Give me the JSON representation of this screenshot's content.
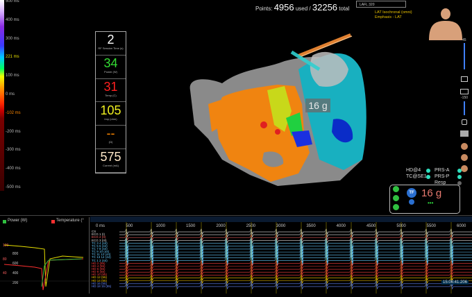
{
  "scale": {
    "labels": [
      {
        "text": "500 ms",
        "color": "#bbbbbb"
      },
      {
        "text": "400 ms",
        "color": "#bbbbbb"
      },
      {
        "text": "300 ms",
        "color": "#bbbbbb"
      },
      {
        "text": "221 ms",
        "color": "#e8e000"
      },
      {
        "text": "100 ms",
        "color": "#bbbbbb"
      },
      {
        "text": "0 ms",
        "color": "#bbbbbb"
      },
      {
        "text": "-102 ms",
        "color": "#ff8800"
      },
      {
        "text": "-200 ms",
        "color": "#bbbbbb"
      },
      {
        "text": "-300 ms",
        "color": "#bbbbbb"
      },
      {
        "text": "-400 ms",
        "color": "#bbbbbb"
      },
      {
        "text": "-500 ms",
        "color": "#bbbbbb"
      }
    ]
  },
  "header": {
    "points_prefix": "Points:",
    "used": "4956",
    "used_suffix": "used /",
    "total": "32256",
    "total_suffix": "total",
    "map_name": "LAFL 320",
    "map_mode": "LAT Isochronal (omni)",
    "emphasis": "Emphasis - LAT"
  },
  "readouts": [
    {
      "value": "2",
      "label": "RF Session Time (s)",
      "color": "#ffffff"
    },
    {
      "value": "34",
      "label": "Power (W)",
      "color": "#33dd33"
    },
    {
      "value": "31",
      "label": "Temp (C)",
      "color": "#ff2020"
    },
    {
      "value": "105",
      "label": "Imp (ohm)",
      "color": "#f0f020"
    },
    {
      "value": "--",
      "label": "(Ω)",
      "color": "#ff8800"
    },
    {
      "value": "575",
      "label": "Current (mA)",
      "color": "#ffe8c8"
    }
  ],
  "map_force": "16 g",
  "toolbar": {
    "number_top": "45",
    "number_mid": "-150"
  },
  "force_panel": {
    "hd": "HD@4",
    "tc": "TC@SE1",
    "prs_a": "PRS-A",
    "prs_p": "PRS-P",
    "resp": "Resp",
    "tf": "TF",
    "value": "16 g",
    "dots": "•••"
  },
  "left_panel": {
    "power_label": "Power (W)",
    "temp_label": "Temperature (°",
    "axis": [
      "800",
      "600",
      "400",
      "200"
    ],
    "axis2": [
      "120",
      "80",
      "40"
    ]
  },
  "ecg": {
    "time_labels": [
      "0 ms",
      "500",
      "1000",
      "1500",
      "2000",
      "2500",
      "3000",
      "3500",
      "4000",
      "4500",
      "5000",
      "5500",
      "6000"
    ],
    "timestamp": "15:06:41.206",
    "channels": [
      {
        "name": "CS",
        "color": "#dddddd"
      },
      {
        "name": "ECG 1 (I)",
        "color": "#dddddd"
      },
      {
        "name": "ECG 2 (II)",
        "color": "#ff6666"
      },
      {
        "name": "ECG 3 (III)",
        "color": "#dddddd"
      },
      {
        "name": "TC 3 4 (44)",
        "color": "#66ccff"
      },
      {
        "name": "TC 5 6 (44)",
        "color": "#66ccff"
      },
      {
        "name": "TC 7 8 (44)",
        "color": "#66ccff"
      },
      {
        "name": "TC 9 10 (44)",
        "color": "#66ccff"
      },
      {
        "name": "TC 11 12 (44)",
        "color": "#66ccff"
      },
      {
        "name": "TC 13 14 (44)",
        "color": "#66ccff"
      },
      {
        "name": "TC 1 2 (44)",
        "color": "#66ccff"
      },
      {
        "name": "HD 2 (55)",
        "color": "#ff4040"
      },
      {
        "name": "HD 4 (55)",
        "color": "#ff4040"
      },
      {
        "name": "HD 6 (55)",
        "color": "#ff4040"
      },
      {
        "name": "HD 8 (55)",
        "color": "#ff4040"
      },
      {
        "name": "HD 10 (55)",
        "color": "#ff4040"
      },
      {
        "name": "HD 12 (55)",
        "color": "#ffcc00"
      },
      {
        "name": "HD 14 (55)",
        "color": "#ffcc00"
      },
      {
        "name": "HD 16 (55)",
        "color": "#6688ff"
      },
      {
        "name": "HD 18 15 (55)",
        "color": "#6688ff"
      }
    ]
  }
}
